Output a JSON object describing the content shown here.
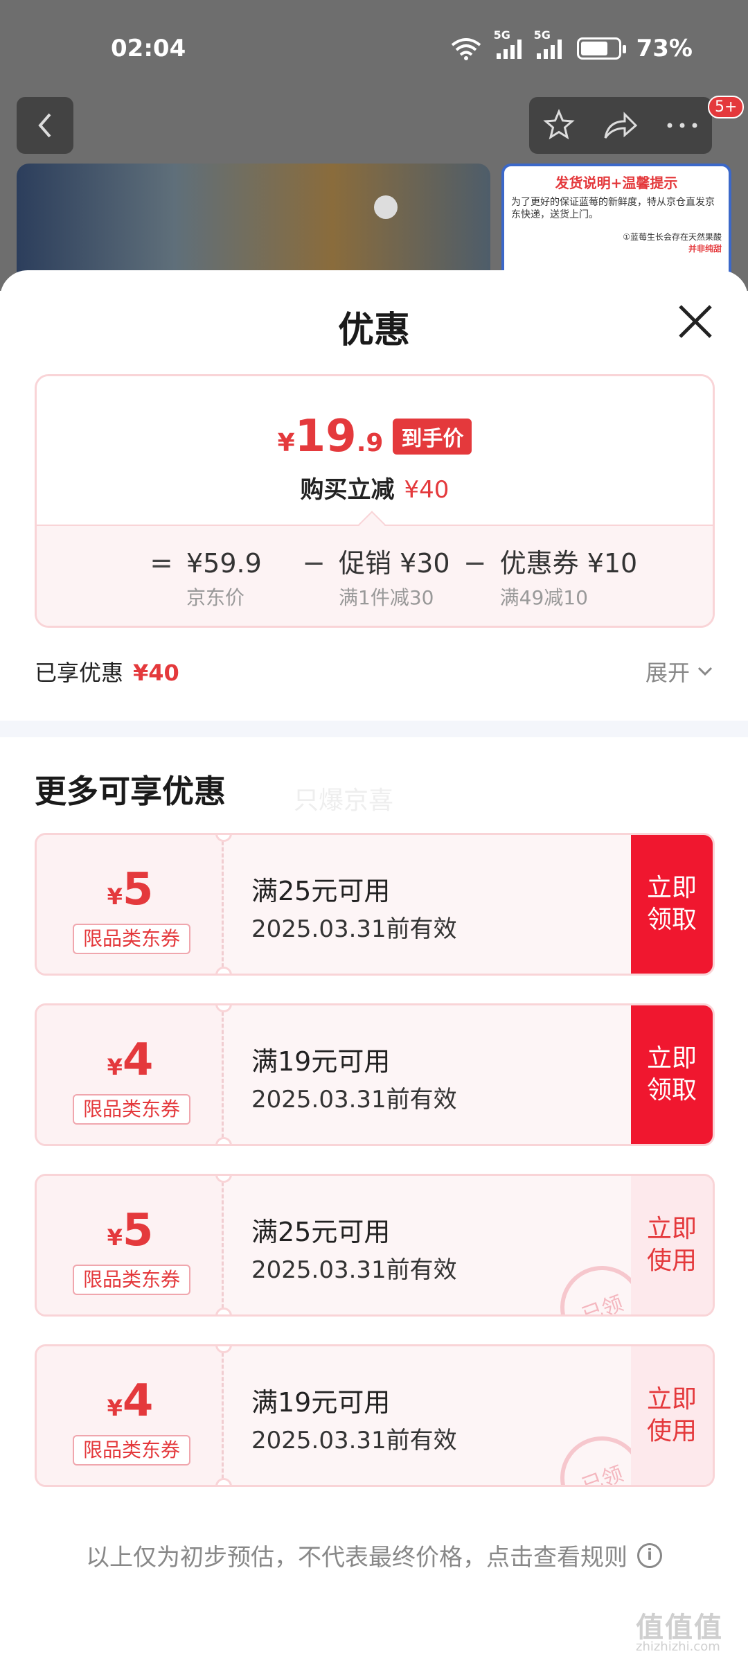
{
  "status_bar": {
    "time": "02:04",
    "network1": "5G",
    "network2": "5G",
    "battery_percent": "73%",
    "battery_level": 0.73
  },
  "nav": {
    "notification_badge": "5+"
  },
  "media": {
    "side_title": "发货说明+温馨提示",
    "side_text": "为了更好的保证蓝莓的新鲜度，特从京仓直发京东快递，送货上门。",
    "side_note_prefix": "①蓝莓生长会存在天然果酸",
    "side_note_highlight": "并非纯甜"
  },
  "sheet": {
    "title": "优惠",
    "price": {
      "currency": "¥",
      "integer": "19",
      "decimal": ".9",
      "tag": "到手价",
      "reduce_label": "购买立减",
      "reduce_value": "¥40"
    },
    "calc": {
      "equals": "=",
      "minus": "−",
      "items": [
        {
          "value": "¥59.9",
          "desc": "京东价"
        },
        {
          "value": "促销 ¥30",
          "desc": "满1件减30"
        },
        {
          "value": "优惠券 ¥10",
          "desc": "满49减10"
        }
      ]
    },
    "enjoyed": {
      "label": "已享优惠",
      "value": "¥40"
    },
    "expand_label": "展开",
    "more_title": "更多可享优惠",
    "watermark": "只爆京喜",
    "coupons": [
      {
        "currency": "¥",
        "amount": "5",
        "category": "限品类东券",
        "condition": "满25元可用",
        "valid": "2025.03.31前有效",
        "action_line1": "立即",
        "action_line2": "领取",
        "claimed": ""
      },
      {
        "currency": "¥",
        "amount": "4",
        "category": "限品类东券",
        "condition": "满19元可用",
        "valid": "2025.03.31前有效",
        "action_line1": "立即",
        "action_line2": "领取",
        "claimed": ""
      },
      {
        "currency": "¥",
        "amount": "5",
        "category": "限品类东券",
        "condition": "满25元可用",
        "valid": "2025.03.31前有效",
        "action_line1": "立即",
        "action_line2": "使用",
        "claimed": "已领"
      },
      {
        "currency": "¥",
        "amount": "4",
        "category": "限品类东券",
        "condition": "满19元可用",
        "valid": "2025.03.31前有效",
        "action_line1": "立即",
        "action_line2": "使用",
        "claimed": "已领"
      }
    ],
    "footnote": "以上仅为初步预估，不代表最终价格，点击查看规则",
    "info_icon": "i"
  },
  "corner_watermark": {
    "logo": "值值值",
    "url": "zhizhizhi.com"
  },
  "colors": {
    "accent": "#e4393c",
    "claim_button": "#f0172f",
    "coupon_border": "#f9d4d7"
  }
}
